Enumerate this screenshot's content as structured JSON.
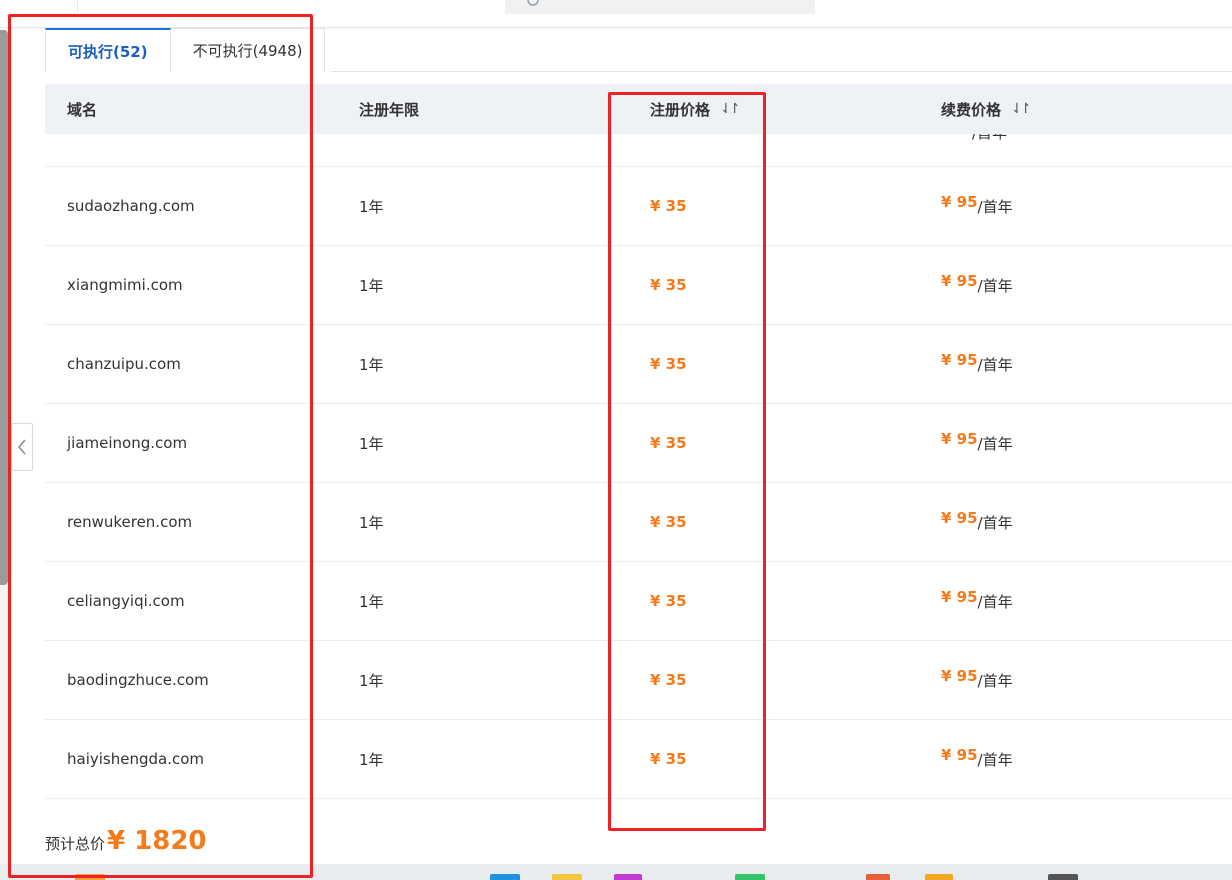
{
  "tabs": [
    {
      "label": "可执行(52)",
      "active": true
    },
    {
      "label": "不可执行(4948)",
      "active": false
    }
  ],
  "table": {
    "headers": {
      "domain": "域名",
      "years": "注册年限",
      "reg_price": "注册价格",
      "renew_price": "续费价格"
    },
    "sort_icon": "⇃↾",
    "partial_row": {
      "renew_unit": "/首年"
    },
    "rows": [
      {
        "domain": "sudaozhang.com",
        "years": "1年",
        "reg_price": "¥ 35",
        "renew_price": "¥ 95",
        "renew_unit": "/首年"
      },
      {
        "domain": "xiangmimi.com",
        "years": "1年",
        "reg_price": "¥ 35",
        "renew_price": "¥ 95",
        "renew_unit": "/首年"
      },
      {
        "domain": "chanzuipu.com",
        "years": "1年",
        "reg_price": "¥ 35",
        "renew_price": "¥ 95",
        "renew_unit": "/首年"
      },
      {
        "domain": "jiameinong.com",
        "years": "1年",
        "reg_price": "¥ 35",
        "renew_price": "¥ 95",
        "renew_unit": "/首年"
      },
      {
        "domain": "renwukeren.com",
        "years": "1年",
        "reg_price": "¥ 35",
        "renew_price": "¥ 95",
        "renew_unit": "/首年"
      },
      {
        "domain": "celiangyiqi.com",
        "years": "1年",
        "reg_price": "¥ 35",
        "renew_price": "¥ 95",
        "renew_unit": "/首年"
      },
      {
        "domain": "baodingzhuce.com",
        "years": "1年",
        "reg_price": "¥ 35",
        "renew_price": "¥ 95",
        "renew_unit": "/首年"
      },
      {
        "domain": "haiyishengda.com",
        "years": "1年",
        "reg_price": "¥ 35",
        "renew_price": "¥ 95",
        "renew_unit": "/首年"
      }
    ]
  },
  "total": {
    "label": "预计总价",
    "value": "¥ 1820"
  },
  "colors": {
    "accent_blue": "#1a5fbf",
    "price_orange": "#f47a1a",
    "header_bg": "#eef1f6",
    "annotation_red": "#ee2222"
  },
  "icons": {
    "collapse": "chevron-left-icon",
    "sort": "sort-icon",
    "search": "search-icon"
  }
}
